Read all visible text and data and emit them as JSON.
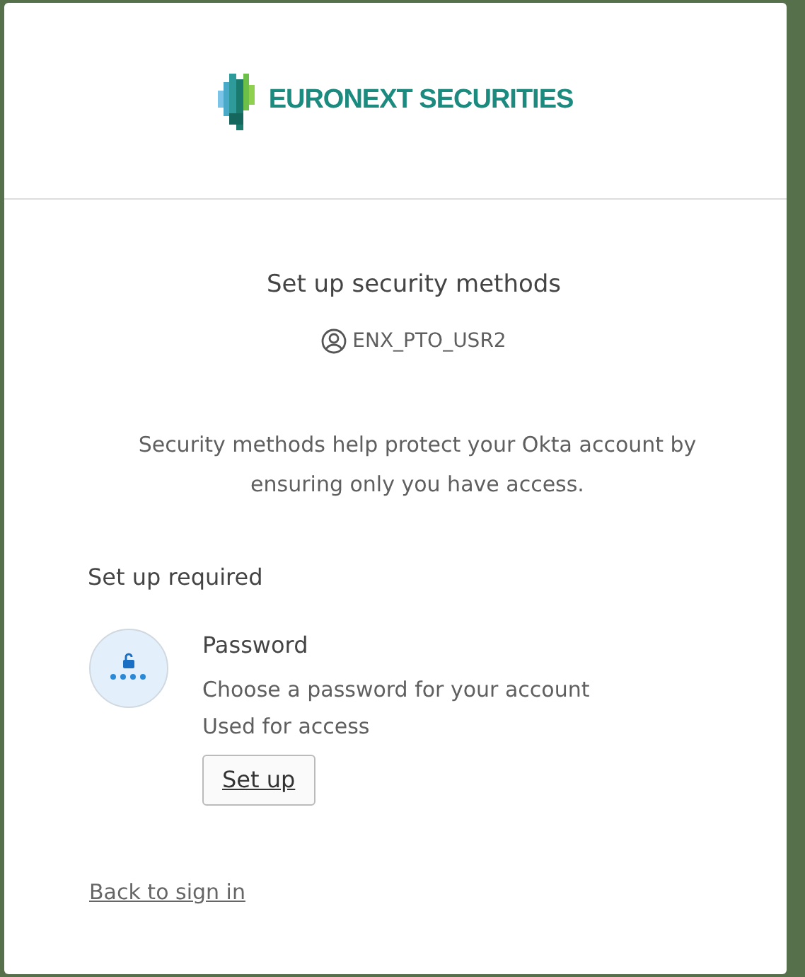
{
  "brand": {
    "name": "EURONEXT SECURITIES"
  },
  "title": "Set up security methods",
  "username": "ENX_PTO_USR2",
  "description": "Security methods help protect your Okta account by ensuring only you have access.",
  "section_title": "Set up required",
  "methods": [
    {
      "kind": "password",
      "name": "Password",
      "description": "Choose a password for your account",
      "usage": "Used for access",
      "button": "Set up"
    }
  ],
  "back_link": "Back to sign in"
}
